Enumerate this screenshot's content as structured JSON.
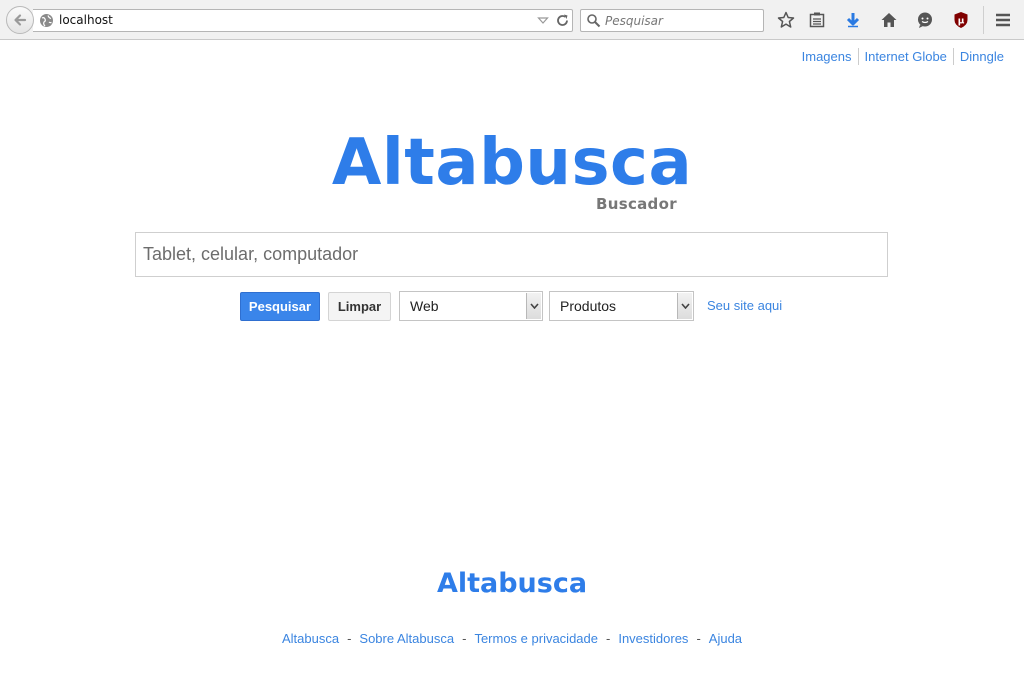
{
  "browser": {
    "url": "localhost",
    "search_placeholder": "Pesquisar",
    "ublock_label": "µ"
  },
  "top_links": [
    "Imagens",
    "Internet Globe",
    "Dinngle"
  ],
  "logo": "Altabusca",
  "tagline": "Buscador",
  "search": {
    "placeholder": "Tablet, celular, computador",
    "value": ""
  },
  "buttons": {
    "search": "Pesquisar",
    "clear": "Limpar"
  },
  "selects": {
    "type": "Web",
    "category": "Produtos"
  },
  "site_link": "Seu site aqui",
  "footer": {
    "logo": "Altabusca",
    "links": [
      "Altabusca",
      "Sobre Altabusca",
      "Termos e privacidade",
      "Investidores",
      "Ajuda"
    ]
  },
  "colors": {
    "brand": "#2e7de9",
    "link": "#3b85e0",
    "search_button": "#3a85ea"
  }
}
